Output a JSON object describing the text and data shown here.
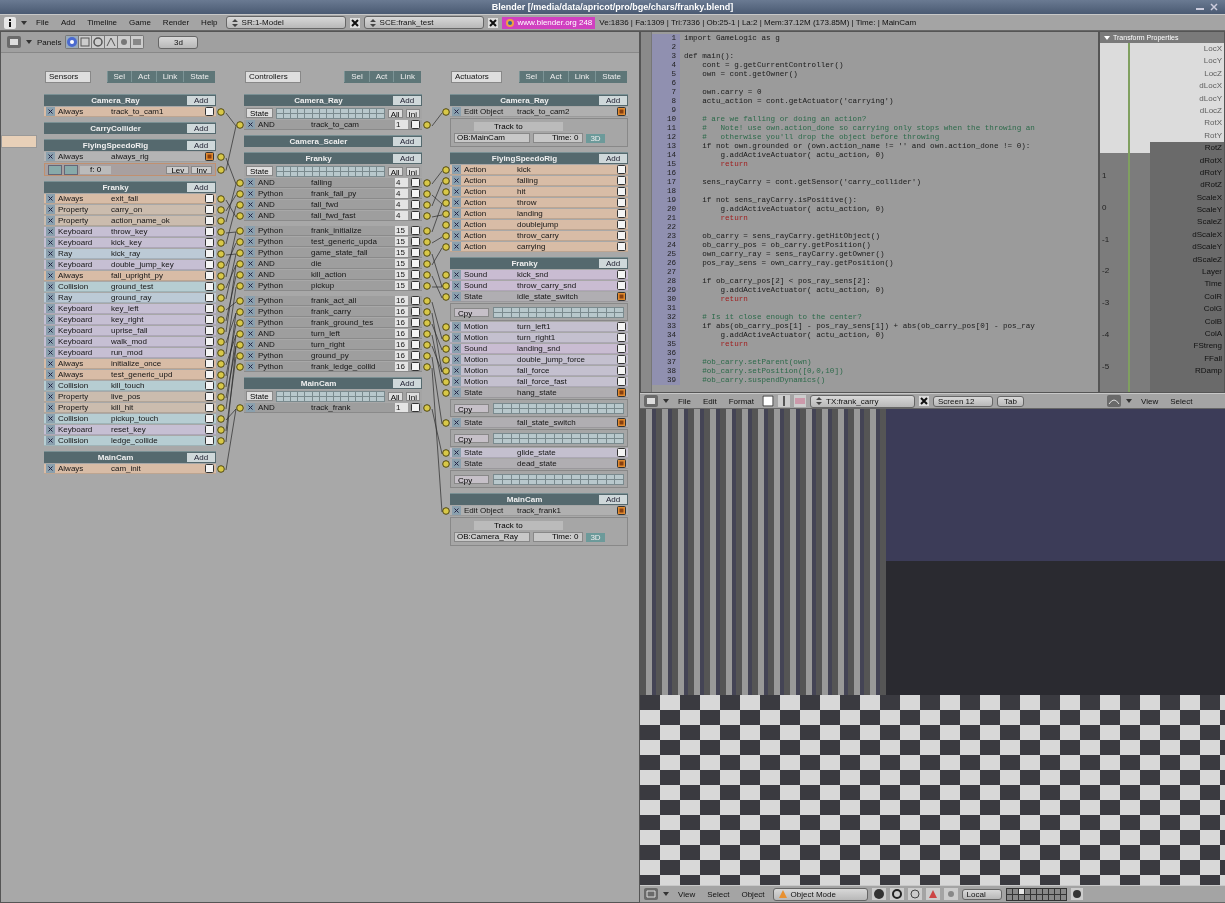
{
  "window": {
    "title": "Blender [/media/data/apricot/pro/bge/chars/franky.blend]"
  },
  "header": {
    "menus": [
      "File",
      "Add",
      "Timeline",
      "Game",
      "Render",
      "Help"
    ],
    "screen": "SR:1-Model",
    "scene": "SCE:frank_test",
    "version": "www.blender.org 248",
    "stats": "Ve:1836 | Fa:1309 | Tri:7336 | Ob:25-1 | La:2  | Mem:37.12M (173.85M)  | Time:  | MainCam"
  },
  "logic": {
    "panels_label": "Panels",
    "layer_field": "3d",
    "sensors": {
      "label": "Sensors",
      "filters": [
        "Sel",
        "Act",
        "Link",
        "State"
      ],
      "objects": [
        {
          "name": "Camera_Ray",
          "add": "Add",
          "rows": [
            {
              "kind": "brick",
              "type": "Always",
              "name": "track_to_cam1",
              "color": "#d8bca6",
              "expanded": false
            }
          ]
        },
        {
          "name": "CarryCollider",
          "add": "Add"
        },
        {
          "name": "FlyingSpeedoRig",
          "add": "Add",
          "rows": [
            {
              "kind": "brick",
              "type": "Always",
              "name": "always_rig",
              "color": "#b4b4b4",
              "expanded": true
            },
            {
              "kind": "options",
              "fields": [
                "f: 0",
                "Lev",
                "Inv"
              ]
            }
          ]
        },
        {
          "name": "Franky",
          "add": "Add",
          "rows": [
            {
              "kind": "brick",
              "type": "Always",
              "name": "exit_fall",
              "color": "#d8bca6",
              "expanded": false
            },
            {
              "kind": "brick",
              "type": "Property",
              "name": "carry_on",
              "color": "#cbbcae",
              "expanded": false
            },
            {
              "kind": "brick",
              "type": "Property",
              "name": "action_name_ok",
              "color": "#cbbcae",
              "expanded": false
            },
            {
              "kind": "brick",
              "type": "Keyboard",
              "name": "throw_key",
              "color": "#c6bfd3",
              "expanded": false
            },
            {
              "kind": "brick",
              "type": "Keyboard",
              "name": "kick_key",
              "color": "#c6bfd3",
              "expanded": false
            },
            {
              "kind": "brick",
              "type": "Ray",
              "name": "kick_ray",
              "color": "#bccad6",
              "expanded": false
            },
            {
              "kind": "brick",
              "type": "Keyboard",
              "name": "double_jump_key",
              "color": "#c6bfd3",
              "expanded": false
            },
            {
              "kind": "brick",
              "type": "Always",
              "name": "fall_upright_py",
              "color": "#d8bca6",
              "expanded": false
            },
            {
              "kind": "brick",
              "type": "Collision",
              "name": "ground_test",
              "color": "#b6cdd2",
              "expanded": false
            },
            {
              "kind": "brick",
              "type": "Ray",
              "name": "ground_ray",
              "color": "#bccad6",
              "expanded": false
            },
            {
              "kind": "brick",
              "type": "Keyboard",
              "name": "key_left",
              "color": "#c6bfd3",
              "expanded": false
            },
            {
              "kind": "brick",
              "type": "Keyboard",
              "name": "key_right",
              "color": "#c6bfd3",
              "expanded": false
            },
            {
              "kind": "brick",
              "type": "Keyboard",
              "name": "uprise_fall",
              "color": "#c6bfd3",
              "expanded": false
            },
            {
              "kind": "brick",
              "type": "Keyboard",
              "name": "walk_mod",
              "color": "#c6bfd3",
              "expanded": false
            },
            {
              "kind": "brick",
              "type": "Keyboard",
              "name": "run_mod",
              "color": "#c6bfd3",
              "expanded": false
            },
            {
              "kind": "brick",
              "type": "Always",
              "name": "initialize_once",
              "color": "#d8bca6",
              "expanded": false
            },
            {
              "kind": "brick",
              "type": "Always",
              "name": "test_generic_upd",
              "color": "#d8bca6",
              "expanded": false
            },
            {
              "kind": "brick",
              "type": "Collision",
              "name": "kill_touch",
              "color": "#b6cdd2",
              "expanded": false
            },
            {
              "kind": "brick",
              "type": "Property",
              "name": "live_pos",
              "color": "#cbbcae",
              "expanded": false
            },
            {
              "kind": "brick",
              "type": "Property",
              "name": "kill_hit",
              "color": "#cbbcae",
              "expanded": false
            },
            {
              "kind": "brick",
              "type": "Collision",
              "name": "pickup_touch",
              "color": "#b6cdd2",
              "expanded": false
            },
            {
              "kind": "brick",
              "type": "Keyboard",
              "name": "reset_key",
              "color": "#c6bfd3",
              "expanded": false
            },
            {
              "kind": "brick",
              "type": "Collision",
              "name": "ledge_collide",
              "color": "#b6cdd2",
              "expanded": false
            }
          ]
        },
        {
          "name": "MainCam",
          "add": "Add",
          "rows": [
            {
              "kind": "brick",
              "type": "Always",
              "name": "cam_init",
              "color": "#d8bca6",
              "expanded": false
            }
          ]
        }
      ]
    },
    "controllers": {
      "label": "Controllers",
      "filters": [
        "Sel",
        "Act",
        "Link"
      ],
      "objects": [
        {
          "name": "Camera_Ray",
          "add": "Add",
          "state_label": "State",
          "state_buttons": [
            "All",
            "Ini"
          ],
          "rows": [
            {
              "type": "AND",
              "name": "track_to_cam",
              "state": "1",
              "expanded": false
            }
          ]
        },
        {
          "name": "Camera_Scaler",
          "add": "Add"
        },
        {
          "name": "Franky",
          "add": "Add",
          "state_label": "State",
          "state_buttons": [
            "All",
            "Ini"
          ],
          "rows": [
            {
              "type": "AND",
              "name": "falling",
              "state": "4",
              "expanded": false
            },
            {
              "type": "Python",
              "name": "frank_fall_py",
              "state": "4",
              "expanded": false
            },
            {
              "type": "AND",
              "name": "fall_fwd",
              "state": "4",
              "expanded": false
            },
            {
              "type": "AND",
              "name": "fall_fwd_fast",
              "state": "4",
              "expanded": false
            },
            {
              "type": "Python",
              "name": "frank_initialize",
              "state": "15",
              "expanded": false
            },
            {
              "type": "Python",
              "name": "test_generic_upda",
              "state": "15",
              "expanded": false
            },
            {
              "type": "Python",
              "name": "game_state_fall",
              "state": "15",
              "expanded": false
            },
            {
              "type": "AND",
              "name": "die",
              "state": "15",
              "expanded": false
            },
            {
              "type": "AND",
              "name": "kill_action",
              "state": "15",
              "expanded": false
            },
            {
              "type": "Python",
              "name": "pickup",
              "state": "15",
              "expanded": false
            },
            {
              "type": "Python",
              "name": "frank_act_all",
              "state": "16",
              "expanded": false
            },
            {
              "type": "Python",
              "name": "frank_carry",
              "state": "16",
              "expanded": false
            },
            {
              "type": "Python",
              "name": "frank_ground_tes",
              "state": "16",
              "expanded": false
            },
            {
              "type": "AND",
              "name": "turn_left",
              "state": "16",
              "expanded": false
            },
            {
              "type": "AND",
              "name": "turn_right",
              "state": "16",
              "expanded": false
            },
            {
              "type": "Python",
              "name": "ground_py",
              "state": "16",
              "expanded": false
            },
            {
              "type": "Python",
              "name": "frank_ledge_collid",
              "state": "16",
              "expanded": false
            }
          ]
        },
        {
          "name": "MainCam",
          "add": "Add",
          "state_label": "State",
          "state_buttons": [
            "All",
            "Ini"
          ],
          "rows": [
            {
              "type": "AND",
              "name": "track_frank",
              "state": "1",
              "expanded": false
            }
          ]
        }
      ]
    },
    "actuators": {
      "label": "Actuators",
      "filters": [
        "Sel",
        "Act",
        "Link",
        "State"
      ],
      "objects": [
        {
          "name": "Camera_Ray",
          "add": "Add",
          "rows": [
            {
              "kind": "brick",
              "type": "Edit Object",
              "name": "track_to_cam2",
              "color": "#b0b0b0",
              "expanded": true
            },
            {
              "kind": "track",
              "mode": "Track to",
              "object": "OB:MainCam",
              "time": "Time: 0",
              "toggle": "3D"
            }
          ]
        },
        {
          "name": "FlyingSpeedoRig",
          "add": "Add",
          "rows": [
            {
              "kind": "brick",
              "type": "Action",
              "name": "kick",
              "color": "#d8bca6",
              "expanded": false
            },
            {
              "kind": "brick",
              "type": "Action",
              "name": "falling",
              "color": "#d8bca6",
              "expanded": false
            },
            {
              "kind": "brick",
              "type": "Action",
              "name": "hit",
              "color": "#d8bca6",
              "expanded": false
            },
            {
              "kind": "brick",
              "type": "Action",
              "name": "throw",
              "color": "#d8bca6",
              "expanded": false
            },
            {
              "kind": "brick",
              "type": "Action",
              "name": "landing",
              "color": "#d8bca6",
              "expanded": false
            },
            {
              "kind": "brick",
              "type": "Action",
              "name": "doublejump",
              "color": "#d8bca6",
              "expanded": false
            },
            {
              "kind": "brick",
              "type": "Action",
              "name": "throw_carry",
              "color": "#d8bca6",
              "expanded": false
            },
            {
              "kind": "brick",
              "type": "Action",
              "name": "carrying",
              "color": "#d8bca6",
              "expanded": false
            }
          ]
        },
        {
          "name": "Franky",
          "add": "Add",
          "rows": [
            {
              "kind": "brick",
              "type": "Sound",
              "name": "kick_snd",
              "color": "#c9bcd2",
              "expanded": false
            },
            {
              "kind": "brick",
              "type": "Sound",
              "name": "throw_carry_snd",
              "color": "#c9bcd2",
              "expanded": false
            },
            {
              "kind": "brick",
              "type": "State",
              "name": "idle_state_switch",
              "color": "#b0aeb2",
              "expanded": true
            },
            {
              "kind": "state_mask",
              "op": "Cpy"
            },
            {
              "kind": "brick",
              "type": "Motion",
              "name": "turn_left1",
              "color": "#c4c0cf",
              "expanded": false
            },
            {
              "kind": "brick",
              "type": "Motion",
              "name": "turn_right1",
              "color": "#c4c0cf",
              "expanded": false
            },
            {
              "kind": "brick",
              "type": "Sound",
              "name": "landing_snd",
              "color": "#c9bcd2",
              "expanded": false
            },
            {
              "kind": "brick",
              "type": "Motion",
              "name": "double_jump_force",
              "color": "#c4c0cf",
              "expanded": false
            },
            {
              "kind": "brick",
              "type": "Motion",
              "name": "fall_force",
              "color": "#c4c0cf",
              "expanded": false
            },
            {
              "kind": "brick",
              "type": "Motion",
              "name": "fall_force_fast",
              "color": "#c4c0cf",
              "expanded": false
            },
            {
              "kind": "brick",
              "type": "State",
              "name": "hang_state",
              "color": "#b0aeb2",
              "expanded": true
            },
            {
              "kind": "state_mask",
              "op": "Cpy"
            },
            {
              "kind": "brick",
              "type": "State",
              "name": "fall_state_switch",
              "color": "#b0aeb2",
              "expanded": true
            },
            {
              "kind": "state_mask",
              "op": "Cpy"
            },
            {
              "kind": "brick",
              "type": "State",
              "name": "glide_state",
              "color": "#c4c0cf",
              "expanded": false
            },
            {
              "kind": "brick",
              "type": "State",
              "name": "dead_state",
              "color": "#b0aeb2",
              "expanded": true
            },
            {
              "kind": "state_mask",
              "op": "Cpy"
            }
          ]
        },
        {
          "name": "MainCam",
          "add": "Add",
          "rows": [
            {
              "kind": "brick",
              "type": "Edit Object",
              "name": "track_frank1",
              "color": "#b0b0b0",
              "expanded": true
            },
            {
              "kind": "track",
              "mode": "Track to",
              "object": "OB:Camera_Ray",
              "time": "Time: 0",
              "toggle": "3D"
            }
          ]
        }
      ]
    }
  },
  "text_editor": {
    "lines": [
      {
        "n": "1",
        "text": "import GameLogic as g",
        "kind": "code"
      },
      {
        "n": "2"
      },
      {
        "n": "3",
        "text": "def main():",
        "kind": "code"
      },
      {
        "n": "4",
        "text": "    cont = g.getCurrentController()",
        "kind": "code"
      },
      {
        "n": "5",
        "text": "    own = cont.getOwner()",
        "kind": "code"
      },
      {
        "n": "6"
      },
      {
        "n": "7",
        "text": "    own.carry = 0",
        "kind": "code"
      },
      {
        "n": "8",
        "text": "    actu_action = cont.getActuator('carrying')",
        "kind": "code"
      },
      {
        "n": "9"
      },
      {
        "n": "10",
        "text": "    # are we falling or doing an action?",
        "kind": "comment"
      },
      {
        "n": "11",
        "text": "    #   Note! use own.action_done so carrying only stops when the throwing an",
        "kind": "comment"
      },
      {
        "n": "12",
        "text": "    #   otherwise you'll drop the object before throwing",
        "kind": "comment"
      },
      {
        "n": "13",
        "text": "    if not own.grounded or (own.action_name != '' and own.action_done != 0):",
        "kind": "code"
      },
      {
        "n": "14",
        "text": "        g.addActiveActuator( actu_action, 0)",
        "kind": "code"
      },
      {
        "n": "15",
        "text": "        return",
        "kind": "keyword"
      },
      {
        "n": "16"
      },
      {
        "n": "17",
        "text": "    sens_rayCarry = cont.getSensor('carry_collider')",
        "kind": "code"
      },
      {
        "n": "18"
      },
      {
        "n": "19",
        "text": "    if not sens_rayCarry.isPositive():",
        "kind": "code"
      },
      {
        "n": "20",
        "text": "        g.addActiveActuator( actu_action, 0)",
        "kind": "code"
      },
      {
        "n": "21",
        "text": "        return",
        "kind": "keyword"
      },
      {
        "n": "22"
      },
      {
        "n": "23",
        "text": "    ob_carry = sens_rayCarry.getHitObject()",
        "kind": "code"
      },
      {
        "n": "24",
        "text": "    ob_carry_pos = ob_carry.getPosition()",
        "kind": "code"
      },
      {
        "n": "25",
        "text": "    own_carry_ray = sens_rayCarry.getOwner()",
        "kind": "code"
      },
      {
        "n": "26",
        "text": "    pos_ray_sens = own_carry_ray.getPosition()",
        "kind": "code"
      },
      {
        "n": "27"
      },
      {
        "n": "28",
        "text": "    if ob_carry_pos[2] < pos_ray_sens[2]:",
        "kind": "code"
      },
      {
        "n": "29",
        "text": "        g.addActiveActuator( actu_action, 0)",
        "kind": "code"
      },
      {
        "n": "30",
        "text": "        return",
        "kind": "keyword"
      },
      {
        "n": "31"
      },
      {
        "n": "32",
        "text": "    # Is it close enough to the center?",
        "kind": "comment"
      },
      {
        "n": "33",
        "text": "    if abs(ob_carry_pos[1] - pos_ray_sens[1]) + abs(ob_carry_pos[0] - pos_ray",
        "kind": "code"
      },
      {
        "n": "34",
        "text": "        g.addActiveActuator( actu_action, 0)",
        "kind": "code"
      },
      {
        "n": "35",
        "text": "        return",
        "kind": "keyword"
      },
      {
        "n": "36"
      },
      {
        "n": "37",
        "text": "    #ob_carry.setParent(own)",
        "kind": "comment"
      },
      {
        "n": "38",
        "text": "    #ob_carry.setPosition([0,0,10])",
        "kind": "comment"
      },
      {
        "n": "39",
        "text": "    #ob_carry.suspendDynamics()",
        "kind": "comment"
      }
    ]
  },
  "ipo": {
    "panel_title": "Transform Properties",
    "ticks": [
      "1",
      "0",
      "-1",
      "-2",
      "-3",
      "-4",
      "-5"
    ],
    "channels": [
      {
        "label": "LocX",
        "dimmed": true
      },
      {
        "label": "LocY",
        "dimmed": true
      },
      {
        "label": "LocZ",
        "dimmed": true
      },
      {
        "label": "dLocX",
        "dimmed": true
      },
      {
        "label": "dLocY",
        "dimmed": true
      },
      {
        "label": "dLocZ",
        "dimmed": true
      },
      {
        "label": "RotX",
        "dimmed": true
      },
      {
        "label": "RotY",
        "dimmed": true
      },
      {
        "label": "RotZ",
        "dimmed": false
      },
      {
        "label": "dRotX",
        "dimmed": false
      },
      {
        "label": "dRotY",
        "dimmed": false
      },
      {
        "label": "dRotZ",
        "dimmed": false
      },
      {
        "label": "ScaleX",
        "dimmed": false
      },
      {
        "label": "ScaleY",
        "dimmed": false
      },
      {
        "label": "ScaleZ",
        "dimmed": false
      },
      {
        "label": "dScaleX",
        "dimmed": false
      },
      {
        "label": "dScaleY",
        "dimmed": false
      },
      {
        "label": "dScaleZ",
        "dimmed": false
      },
      {
        "label": "Layer",
        "dimmed": false
      },
      {
        "label": "Time",
        "dimmed": false
      },
      {
        "label": "ColR",
        "dimmed": false
      },
      {
        "label": "ColG",
        "dimmed": false
      },
      {
        "label": "ColB",
        "dimmed": false
      },
      {
        "label": "ColA",
        "dimmed": false
      },
      {
        "label": "FStreng",
        "dimmed": false
      },
      {
        "label": "FFall",
        "dimmed": false
      },
      {
        "label": "RDamp",
        "dimmed": false
      }
    ]
  },
  "text_header": {
    "menus": [
      "File",
      "Edit",
      "Format"
    ],
    "text_block": "TX:frank_carry",
    "screen": "Screen 12",
    "tab": "Tab"
  },
  "ipo_header": {
    "menus": [
      "View",
      "Select"
    ]
  },
  "view3d_header": {
    "menus": [
      "View",
      "Select",
      "Object"
    ],
    "mode": "Object Mode",
    "orientation": "Local"
  }
}
